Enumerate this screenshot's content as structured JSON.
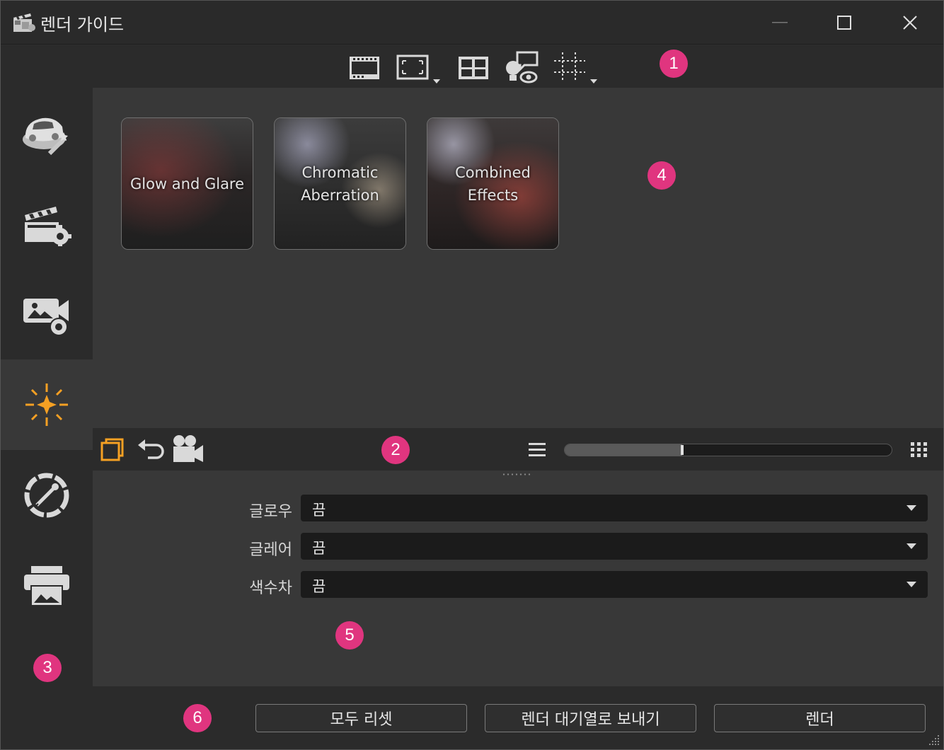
{
  "window": {
    "title": "렌더 가이드",
    "icons": {
      "app": "clapperboard-icon",
      "minimize": "minimize-icon",
      "maximize": "maximize-icon",
      "close": "close-icon"
    }
  },
  "toolbar": {
    "items": [
      {
        "name": "film-frame-icon"
      },
      {
        "name": "region-dropdown-icon"
      },
      {
        "name": "layout-grid-icon"
      },
      {
        "name": "light-preview-icon"
      },
      {
        "name": "grid-dropdown-icon"
      }
    ]
  },
  "sidebar": {
    "items": [
      {
        "name": "car-wand-icon",
        "active": false
      },
      {
        "name": "clapper-gear-icon",
        "active": false
      },
      {
        "name": "camera-gear-icon",
        "active": false
      },
      {
        "name": "sparkle-icon",
        "active": true,
        "accent": "#f5a023"
      },
      {
        "name": "color-picker-icon",
        "active": false
      },
      {
        "name": "printer-icon",
        "active": false
      }
    ]
  },
  "gallery": {
    "cards": [
      {
        "label": "Glow and Glare"
      },
      {
        "label": "Chromatic\nAberration"
      },
      {
        "label": "Combined\nEffects"
      }
    ]
  },
  "midbar": {
    "icons": [
      "copy-icon",
      "undo-icon",
      "movie-camera-icon",
      "list-view-icon",
      "grid-view-icon"
    ],
    "slider": {
      "value": 0.36
    }
  },
  "properties": {
    "rows": [
      {
        "label": "글로우",
        "value": "끔"
      },
      {
        "label": "글레어",
        "value": "끔"
      },
      {
        "label": "색수차",
        "value": "끔"
      }
    ]
  },
  "buttons": {
    "reset": "모두 리셋",
    "queue": "렌더 대기열로 보내기",
    "render": "렌더"
  },
  "callouts": [
    "1",
    "2",
    "3",
    "4",
    "5",
    "6"
  ],
  "colors": {
    "accent": "#f5a023",
    "callout": "#e0357f"
  }
}
